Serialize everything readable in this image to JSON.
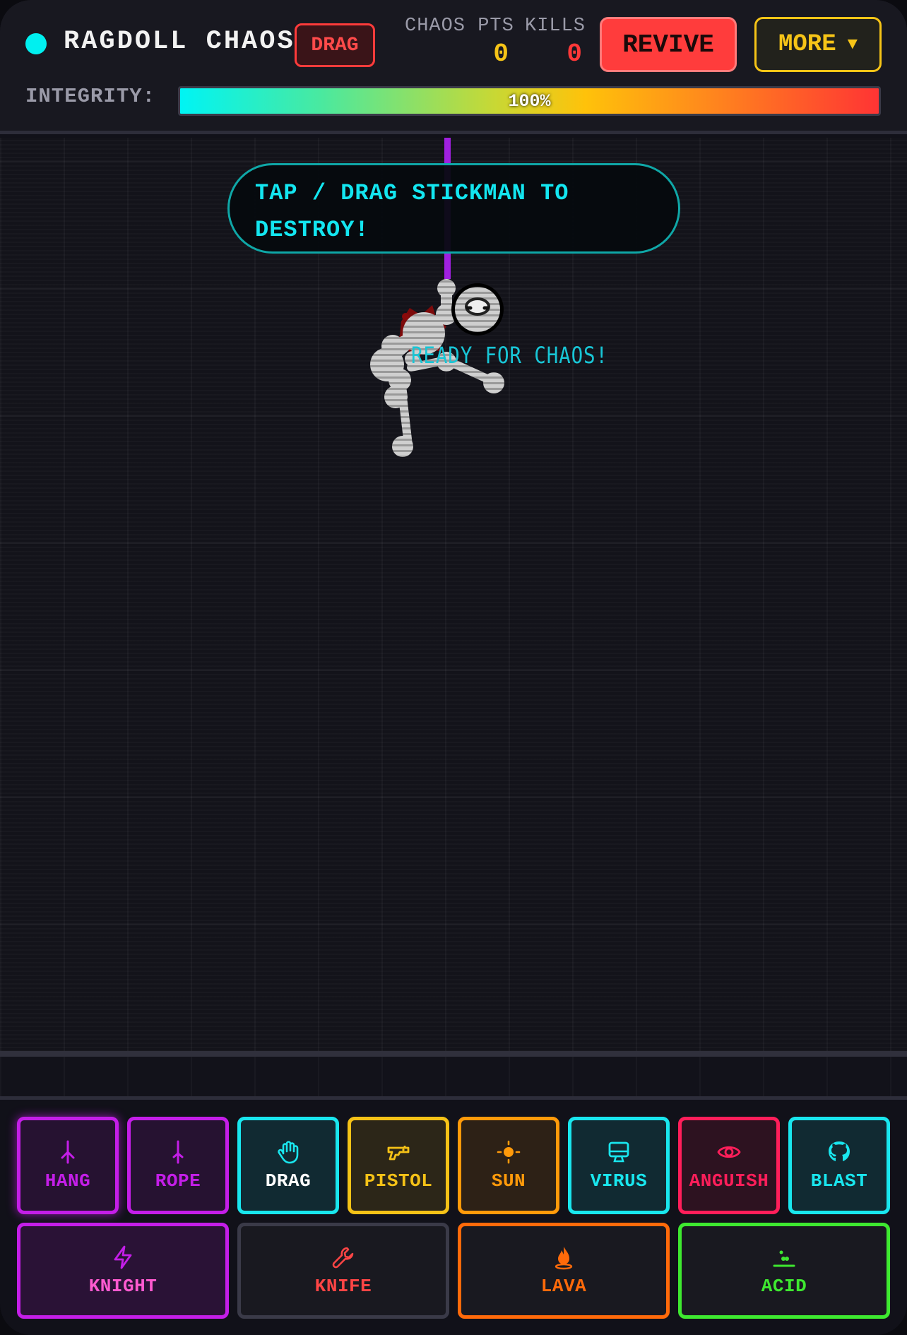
{
  "header": {
    "title": "RAGDOLL CHAOS",
    "mode_badge": "DRAG",
    "chaos_pts_label": "CHAOS PTS",
    "chaos_pts_value": "0",
    "kills_label": "KILLS",
    "kills_value": "0",
    "revive_label": "REVIVE",
    "more_label": "MORE",
    "more_icon": "triangle-down-icon",
    "integrity_label": "INTEGRITY:",
    "integrity_text": "100%",
    "integrity_percent": 100
  },
  "arena": {
    "hint": "TAP / DRAG STICKMAN TO DESTROY!",
    "status": "READY FOR CHAOS!"
  },
  "tools_row1": [
    {
      "id": "hang",
      "label": "HANG",
      "icon": "hanging-hook-icon",
      "color": "#c41ee8"
    },
    {
      "id": "rope",
      "label": "ROPE",
      "icon": "rope-icon",
      "color": "#c41ee8"
    },
    {
      "id": "drag",
      "label": "DRAG",
      "icon": "hand-icon",
      "color": "#19e6ee"
    },
    {
      "id": "pistol",
      "label": "PISTOL",
      "icon": "pistol-icon",
      "color": "#f5c217"
    },
    {
      "id": "sun",
      "label": "SUN",
      "icon": "sun-icon",
      "color": "#ff9a0a"
    },
    {
      "id": "virus",
      "label": "VIRUS",
      "icon": "computer-icon",
      "color": "#19e6ee"
    },
    {
      "id": "anguish",
      "label": "ANGUISH",
      "icon": "eye-icon",
      "color": "#ff1e5a"
    },
    {
      "id": "blast",
      "label": "BLAST",
      "icon": "github-icon",
      "color": "#19e6ee"
    }
  ],
  "tools_row2": [
    {
      "id": "knight",
      "label": "KNIGHT",
      "icon": "lightning-icon",
      "color": "#c41ee8"
    },
    {
      "id": "knife",
      "label": "KNIFE",
      "icon": "wrench-icon",
      "color": "#ff4545"
    },
    {
      "id": "lava",
      "label": "LAVA",
      "icon": "flame-icon",
      "color": "#ff6a0a"
    },
    {
      "id": "acid",
      "label": "ACID",
      "icon": "acid-drops-icon",
      "color": "#3ee830"
    }
  ]
}
